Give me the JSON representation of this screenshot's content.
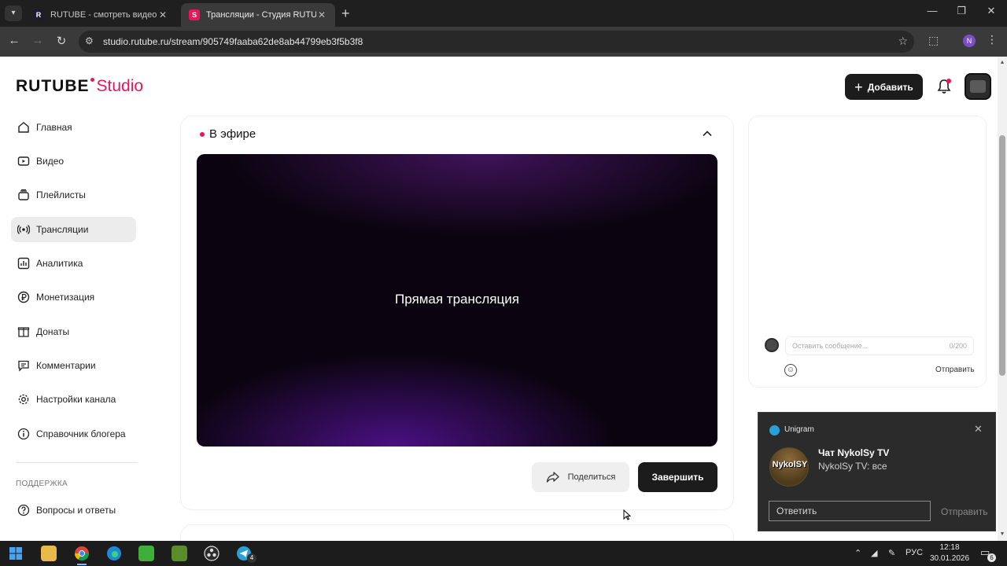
{
  "browser": {
    "tabs": [
      {
        "title": "RUTUBE - смотреть видео онлайн",
        "active": false
      },
      {
        "title": "Трансляции - Студия RUTUBE",
        "active": true
      }
    ],
    "url": "studio.rutube.ru/stream/905749faaba62de8ab44799eb3f5b3f8",
    "profile_initial": "N"
  },
  "header": {
    "logo_main": "RUTUBE",
    "logo_sub": "Studio",
    "add_button": "Добавить"
  },
  "sidebar": {
    "items": [
      {
        "label": "Главная",
        "icon": "home-icon"
      },
      {
        "label": "Видео",
        "icon": "video-icon"
      },
      {
        "label": "Плейлисты",
        "icon": "playlist-icon"
      },
      {
        "label": "Трансляции",
        "icon": "broadcast-icon",
        "active": true
      },
      {
        "label": "Аналитика",
        "icon": "analytics-icon"
      },
      {
        "label": "Монетизация",
        "icon": "ruble-icon"
      },
      {
        "label": "Донаты",
        "icon": "donate-icon"
      },
      {
        "label": "Комментарии",
        "icon": "comment-icon"
      },
      {
        "label": "Настройки канала",
        "icon": "gear-icon"
      },
      {
        "label": "Справочник блогера",
        "icon": "info-icon"
      }
    ],
    "support_title": "ПОДДЕРЖКА",
    "support_items": [
      {
        "label": "Вопросы и ответы",
        "icon": "question-icon"
      }
    ]
  },
  "live": {
    "title": "В эфире",
    "player_label": "Прямая трансляция",
    "share_button": "Поделиться",
    "finish_button": "Завершить"
  },
  "chat": {
    "placeholder": "Оставить сообщение...",
    "counter": "0/200",
    "send": "Отправить"
  },
  "notification": {
    "app": "Unigram",
    "avatar_text": "NykolSY",
    "title": "Чат NykolSy TV",
    "message": "NykolSy TV: все",
    "reply_placeholder": "Ответить",
    "send": "Отправить"
  },
  "taskbar": {
    "language": "РУС",
    "time": "12:18",
    "date": "30.01.2026",
    "telegram_badge": "4",
    "notif_badge": "6"
  },
  "colors": {
    "accent": "#e8175d",
    "dark_button": "#1c1c1c"
  }
}
